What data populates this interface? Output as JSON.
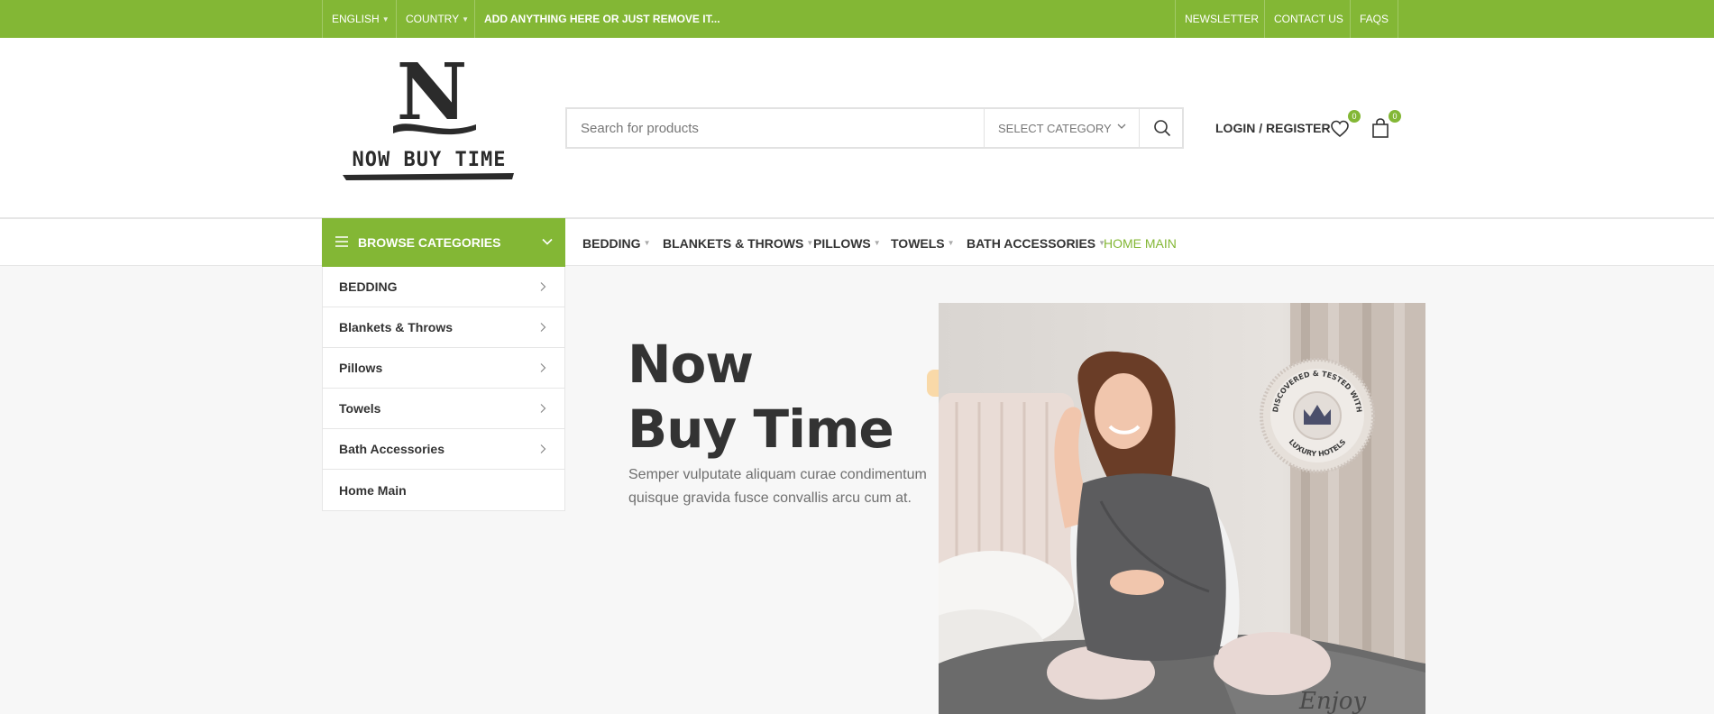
{
  "topbar": {
    "language": "ENGLISH",
    "country": "COUNTRY",
    "promo": "ADD ANYTHING HERE OR JUST REMOVE IT...",
    "links": [
      "NEWSLETTER",
      "CONTACT US",
      "FAQS"
    ]
  },
  "header": {
    "logo": {
      "mark": "N",
      "text": "NOW BUY TIME"
    },
    "search": {
      "placeholder": "Search for products",
      "category": "SELECT CATEGORY"
    },
    "login_label": "LOGIN / REGISTER",
    "wishlist_count": "0",
    "cart_count": "0"
  },
  "nav": {
    "browse_label": "BROWSE CATEGORIES",
    "items": [
      "BEDDING",
      "BLANKETS & THROWS",
      "PILLOWS",
      "TOWELS",
      "BATH ACCESSORIES",
      "HOME MAIN"
    ]
  },
  "sidebar": {
    "items": [
      "BEDDING",
      "Blankets & Throws",
      "Pillows",
      "Towels",
      "Bath Accessories",
      "Home Main"
    ]
  },
  "hero": {
    "title_line1": "Now",
    "title_line2": "Buy Time",
    "text": "Semper vulputate aliquam curae condimentum quisque gravida fusce convallis arcu cum at.",
    "badge_top": "DISCOVERED & TESTED WITH",
    "badge_bottom": "LUXURY HOTELS",
    "script_text": "Enjoy"
  },
  "colors": {
    "accent": "#83b735",
    "text": "#333333"
  },
  "icons": [
    "menu-icon",
    "search-icon",
    "heart-icon",
    "shopping-bag-icon",
    "chevron-down-icon",
    "chevron-right-icon"
  ]
}
